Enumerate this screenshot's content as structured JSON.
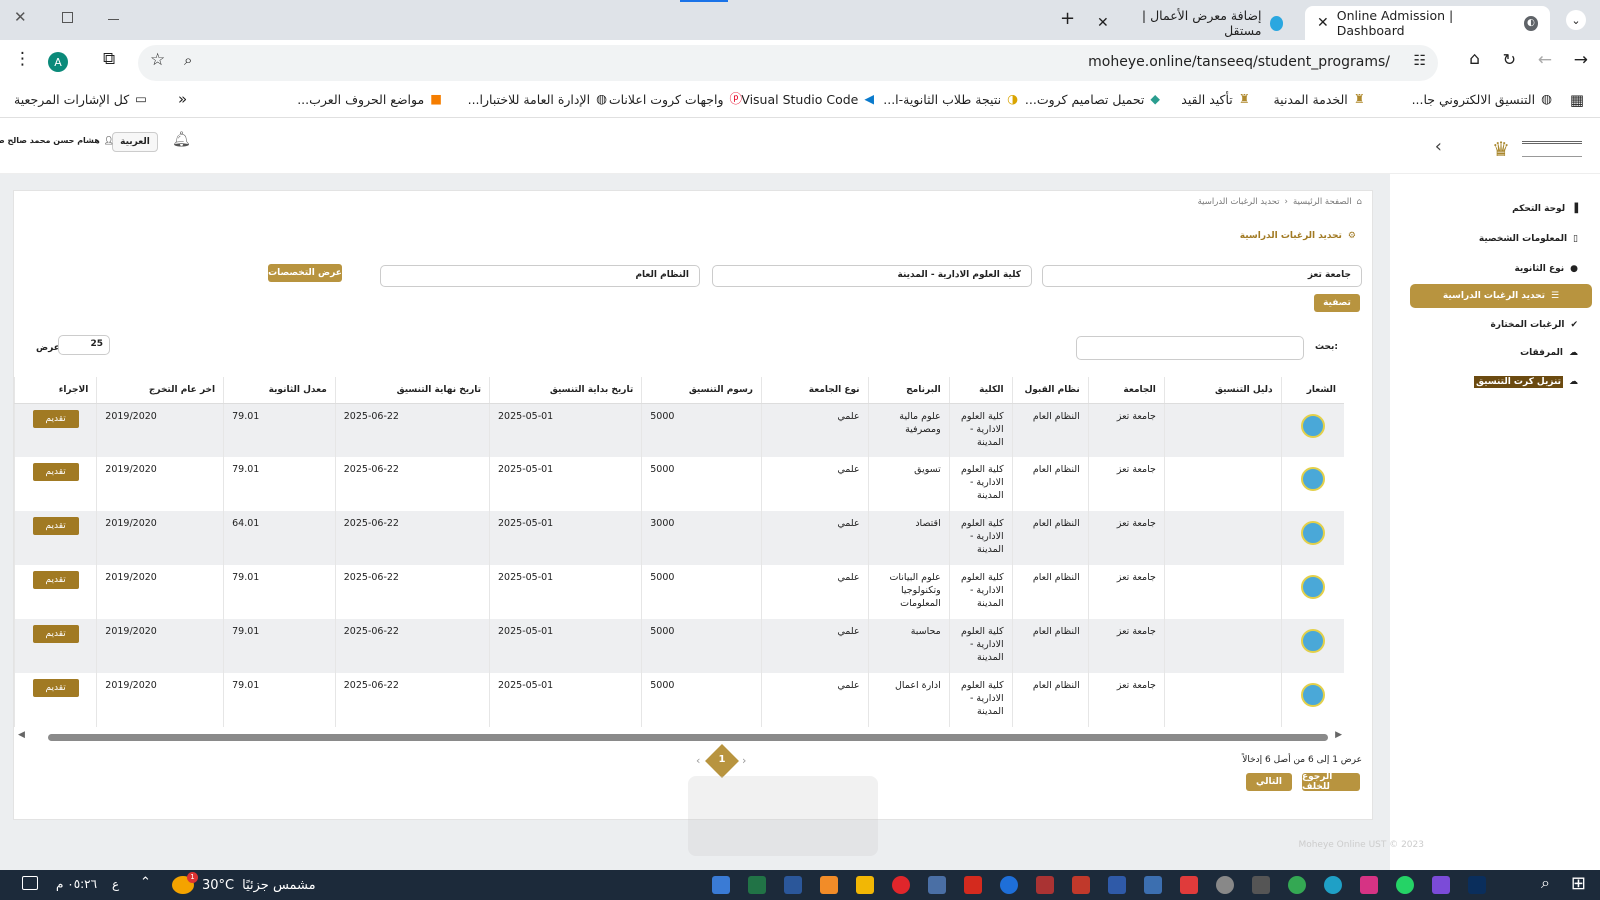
{
  "browser": {
    "tabs": [
      {
        "title": "Online Admission | Dashboard"
      },
      {
        "title": "إضافة معرض الأعمال | مستقل"
      }
    ],
    "url": "moheye.online/tanseeq/student_programs/",
    "profile_initial": "A",
    "bookmarks": [
      "التنسيق الالكتروني جا...",
      "الخدمة المدنية",
      "تأكيد القيد",
      "تحميل تصاميم كروت...",
      "نتيجة طلاب الثانوية-ا...",
      "Visual Studio Code",
      "واجهات كروت اعلانات",
      "الإدارة العامة للاختبارا...",
      "مواضع الحروف العرب..."
    ],
    "all_bookmarks": "كل الإشارات المرجعية"
  },
  "header": {
    "lang": "العربية",
    "user": "هشام حسن محمد صالح صا"
  },
  "sidebar": {
    "items": [
      {
        "label": "لوحة التحكم",
        "icon": "bar-chart-icon"
      },
      {
        "label": "المعلومات الشخصية",
        "icon": "id-card-icon"
      },
      {
        "label": "نوع الثانوية",
        "icon": "circle-icon"
      },
      {
        "label": "تحديد الرغبات الدراسية",
        "icon": "list-icon",
        "active": true
      },
      {
        "label": "الرغبات المختارة",
        "icon": "check-icon"
      },
      {
        "label": "المرفقات",
        "icon": "upload-icon"
      },
      {
        "label": "تنزيل كرت التنسيق",
        "icon": "download-icon"
      }
    ]
  },
  "breadcrumb": {
    "home": "الصفحة الرئيسية",
    "current": "تحديد الرغبات الدراسية"
  },
  "section_title": "تحديد الرغبات الدراسية",
  "filters": {
    "university": "جامعة تعز",
    "college": "كلية العلوم الادارية - المدينة",
    "system": "النظام العام",
    "show_btn": "عرض التخصصات",
    "filter_btn": "تصفية"
  },
  "search_label": "بحث:",
  "show_label": "عرض",
  "page_size": "25",
  "table": {
    "headers": [
      "الشعار",
      "دليل التنسيق",
      "الجامعة",
      "نظام القبول",
      "الكلية",
      "البرنامج",
      "نوع الجامعة",
      "رسوم التنسيق",
      "تاريخ بداية التنسيق",
      "تاريخ نهاية التنسيق",
      "معدل الثانوية",
      "اخر عام التخرج",
      "الاجراء"
    ],
    "rows": [
      {
        "university": "جامعة تعز",
        "system": "النظام العام",
        "college": "كلية العلوم الادارية - المدينة",
        "program": "علوم مالية ومصرفية",
        "type": "علمي",
        "fee": "5000",
        "start": "2025-05-01",
        "end": "2025-06-22",
        "avg": "79.01",
        "year": "2019/2020",
        "action": "تقديم"
      },
      {
        "university": "جامعة تعز",
        "system": "النظام العام",
        "college": "كلية العلوم الادارية - المدينة",
        "program": "تسويق",
        "type": "علمي",
        "fee": "5000",
        "start": "2025-05-01",
        "end": "2025-06-22",
        "avg": "79.01",
        "year": "2019/2020",
        "action": "تقديم"
      },
      {
        "university": "جامعة تعز",
        "system": "النظام العام",
        "college": "كلية العلوم الادارية - المدينة",
        "program": "اقتصاد",
        "type": "علمي",
        "fee": "3000",
        "start": "2025-05-01",
        "end": "2025-06-22",
        "avg": "64.01",
        "year": "2019/2020",
        "action": "تقديم"
      },
      {
        "university": "جامعة تعز",
        "system": "النظام العام",
        "college": "كلية العلوم الادارية - المدينة",
        "program": "علوم البيانات وتكنولوجيا المعلومات",
        "type": "علمي",
        "fee": "5000",
        "start": "2025-05-01",
        "end": "2025-06-22",
        "avg": "79.01",
        "year": "2019/2020",
        "action": "تقديم"
      },
      {
        "university": "جامعة تعز",
        "system": "النظام العام",
        "college": "كلية العلوم الادارية - المدينة",
        "program": "محاسبة",
        "type": "علمي",
        "fee": "5000",
        "start": "2025-05-01",
        "end": "2025-06-22",
        "avg": "79.01",
        "year": "2019/2020",
        "action": "تقديم"
      },
      {
        "university": "جامعة تعز",
        "system": "النظام العام",
        "college": "كلية العلوم الادارية - المدينة",
        "program": "ادارة اعمال",
        "type": "علمي",
        "fee": "5000",
        "start": "2025-05-01",
        "end": "2025-06-22",
        "avg": "79.01",
        "year": "2019/2020",
        "action": "تقديم"
      }
    ]
  },
  "footer": {
    "info": "عرض 1 إلى 6 من أصل 6 إدخالاً",
    "back_btn": "الرجوع للخلف",
    "next_btn": "التالي",
    "page": "1",
    "copyright": "Moheye Online UST © 2023"
  },
  "taskbar": {
    "weather_temp": "30°C",
    "weather_text": "مشمس جزئيًا",
    "time": "٠٥:٢٦ م",
    "lang": "ع",
    "badge": "1"
  }
}
